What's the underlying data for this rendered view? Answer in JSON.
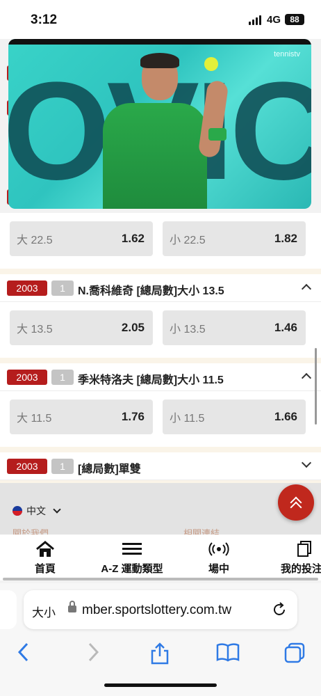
{
  "status": {
    "time": "3:12",
    "network": "4G",
    "battery": "88"
  },
  "video": {
    "logo_text": "tennistv",
    "backdrop_text": "OVIC"
  },
  "markets": [
    {
      "code": "",
      "num": "",
      "title": "",
      "options": [
        {
          "sel": "大 22.5",
          "odds": "1.62"
        },
        {
          "sel": "小 22.5",
          "odds": "1.82"
        }
      ]
    },
    {
      "code": "2003",
      "num": "1",
      "title": "N.喬科維奇 [總局數]大小 13.5",
      "expanded": true,
      "options": [
        {
          "sel": "大 13.5",
          "odds": "2.05"
        },
        {
          "sel": "小 13.5",
          "odds": "1.46"
        }
      ]
    },
    {
      "code": "2003",
      "num": "1",
      "title": "季米特洛夫 [總局數]大小 11.5",
      "expanded": true,
      "options": [
        {
          "sel": "大 11.5",
          "odds": "1.76"
        },
        {
          "sel": "小 11.5",
          "odds": "1.66"
        }
      ]
    },
    {
      "code": "2003",
      "num": "1",
      "title": "[總局數]單雙",
      "expanded": false,
      "options": []
    }
  ],
  "footer": {
    "language": "中文",
    "cutoff_left": "關於我們",
    "cutoff_right": "相關連結"
  },
  "bottom_nav": [
    {
      "label": "首頁",
      "icon": "home-icon"
    },
    {
      "label": "A-Z 運動類型",
      "icon": "menu-icon"
    },
    {
      "label": "場中",
      "icon": "live-icon"
    },
    {
      "label": "我的投注",
      "icon": "copy-icon"
    }
  ],
  "safari": {
    "text_size": "大小",
    "url": "mber.sportslottery.com.tw"
  },
  "colors": {
    "accent": "#b51d1d",
    "badge_grey": "#c4c4c4",
    "odds_bg": "#e6e6e6",
    "safari_blue": "#2f7ae5"
  }
}
